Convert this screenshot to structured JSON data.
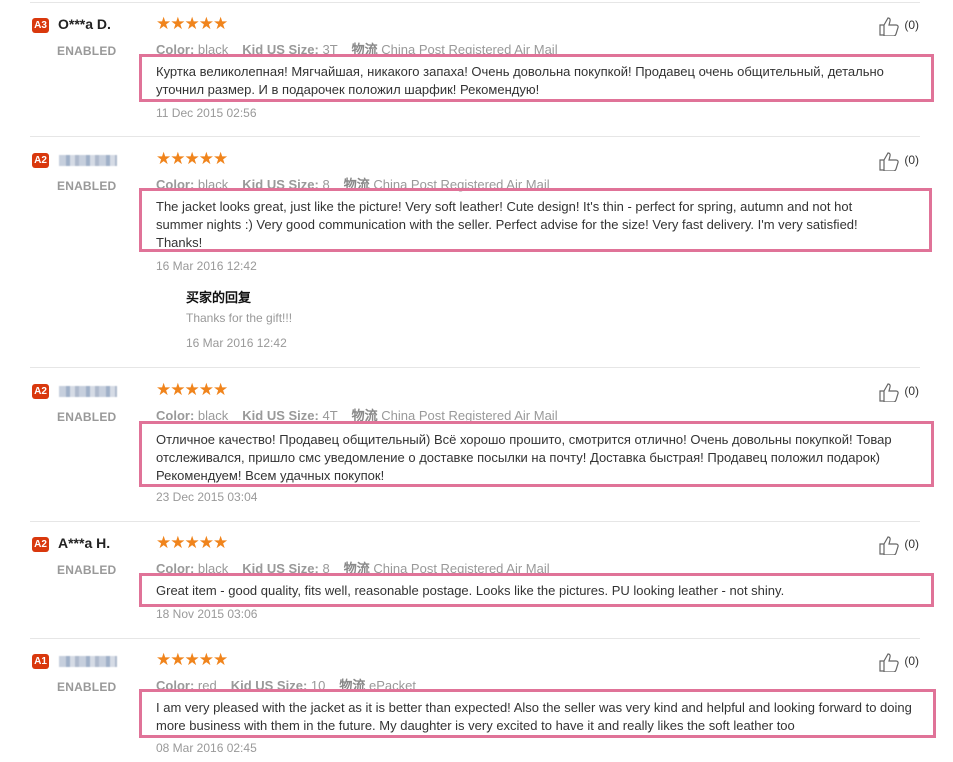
{
  "reviews": [
    {
      "level": "A3",
      "user": "O***a D.",
      "status": "ENABLED",
      "stars": "★★★★★",
      "color_label": "Color:",
      "color": "black",
      "size_label": "Kid US Size:",
      "size": "3T",
      "ship_cn": "物流",
      "shipping": "China Post Registered Air Mail",
      "text": "Куртка великолепная! Мягчайшая, никакого запаха! Очень довольна покупкой! Продавец очень общительный, детально уточнил размер. И в подарочек положил шарфик! Рекомендую!",
      "date": "11 Dec 2015 02:56",
      "likes": "(0)"
    },
    {
      "level": "A2",
      "user": "",
      "status": "ENABLED",
      "stars": "★★★★★",
      "color_label": "Color:",
      "color": "black",
      "size_label": "Kid US Size:",
      "size": "8",
      "ship_cn": "物流",
      "shipping": "China Post Registered Air Mail",
      "text": "The jacket looks great, just like the picture! Very soft leather! Cute design! It's thin - perfect for spring, autumn and not hot summer nights :) Very good communication with the seller. Perfect advise for the size! Very fast delivery. I'm very satisfied! Thanks!",
      "date": "16 Mar 2016 12:42",
      "likes": "(0)",
      "reply": {
        "title": "买家的回复",
        "text": "Thanks for the gift!!!",
        "date": "16 Mar 2016 12:42"
      }
    },
    {
      "level": "A2",
      "user": "",
      "status": "ENABLED",
      "stars": "★★★★★",
      "color_label": "Color:",
      "color": "black",
      "size_label": "Kid US Size:",
      "size": "4T",
      "ship_cn": "物流",
      "shipping": "China Post Registered Air Mail",
      "text": "Отличное качество! Продавец общительный) Всё хорошо прошито, смотрится отлично! Очень довольны покупкой! Товар отслеживался, пришло смс уведомление о доставке посылки на почту! Доставка быстрая! Продавец положил подарок) Рекомендуем! Всем удачных покупок!",
      "date": "23 Dec 2015 03:04",
      "likes": "(0)"
    },
    {
      "level": "A2",
      "user": "A***a H.",
      "status": "ENABLED",
      "stars": "★★★★★",
      "color_label": "Color:",
      "color": "black",
      "size_label": "Kid US Size:",
      "size": "8",
      "ship_cn": "物流",
      "shipping": "China Post Registered Air Mail",
      "text": "Great item - good quality, fits well, reasonable postage. Looks like the pictures. PU looking leather - not shiny.",
      "date": "18 Nov 2015 03:06",
      "likes": "(0)"
    },
    {
      "level": "A1",
      "user": "",
      "status": "ENABLED",
      "stars": "★★★★★",
      "color_label": "Color:",
      "color": "red",
      "size_label": "Kid US Size:",
      "size": "10",
      "ship_cn": "物流",
      "shipping": "ePacket",
      "text": "I am very pleased with the jacket as it is better than expected! Also the seller was very kind and helpful and looking forward to doing more business with them in the future. My daughter is very excited to have it and really likes the soft leather too",
      "date": "08 Mar 2016 02:45",
      "likes": "(0)"
    }
  ],
  "colors": {
    "level_badge": "#d9380d",
    "stars": "#f0841c",
    "highlight_box": "#e07398"
  }
}
